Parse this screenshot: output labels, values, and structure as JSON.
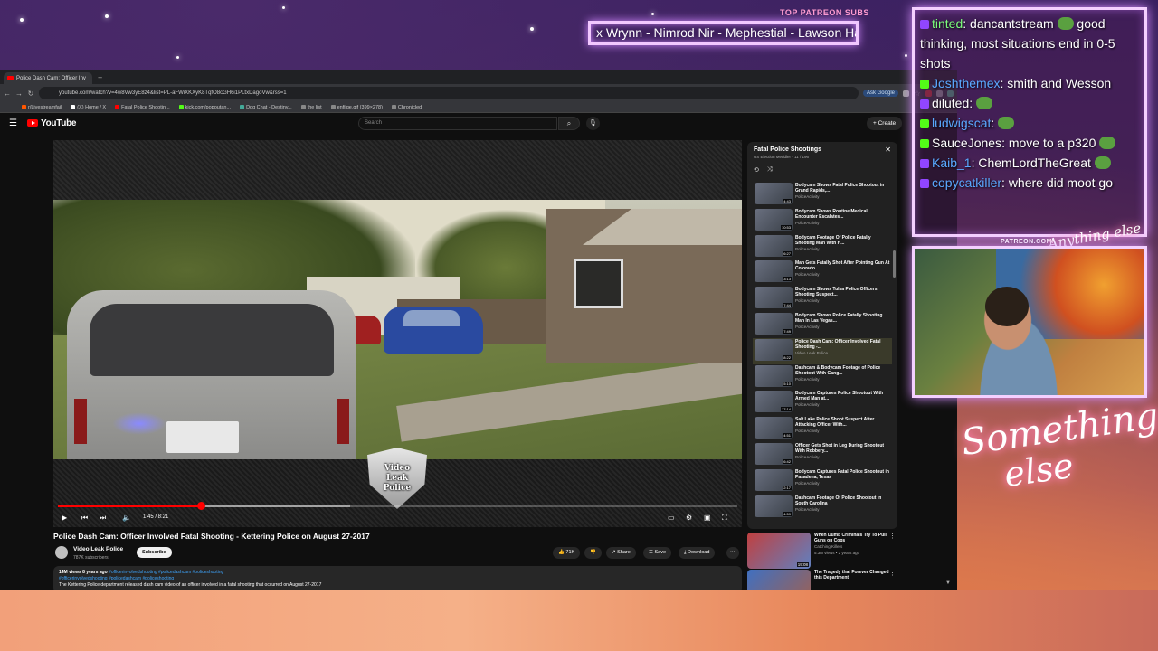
{
  "overlay": {
    "top_subs_label": "TOP PATREON SUBS",
    "top_subs_names": "x Wrynn - Nimrod Nir - Mephestial - Lawson Ha",
    "patreon_url": "PATREON.COM/",
    "signature_small": "Anything else",
    "signature_large_1": "Something",
    "signature_large_2": "else"
  },
  "chat": [
    {
      "user": "tinted",
      "user_color": "#7cfc7c",
      "badge": "twitch",
      "text": "dancantstream",
      "emote_after": true,
      "text2": "good thinking, most situations end in 0-5 shots"
    },
    {
      "user": "Joshthemex",
      "user_color": "#5aa8ff",
      "badge": "kick",
      "text": "smith and Wesson",
      "emote_after": false,
      "text2": ""
    },
    {
      "user": "diluted",
      "user_color": "#ffffff",
      "badge": "twitch",
      "text": "",
      "emote_after": true,
      "text2": ""
    },
    {
      "user": "ludwigscat",
      "user_color": "#5aa8ff",
      "badge": "kick",
      "text": "",
      "emote_after": true,
      "text2": ""
    },
    {
      "user": "SauceJones",
      "user_color": "#ffffff",
      "badge": "kick",
      "text": "move to a p320",
      "emote_after": true,
      "text2": ""
    },
    {
      "user": "Kaib_1",
      "user_color": "#5aa8ff",
      "badge": "twitch",
      "text": "ChemLordTheGreat",
      "emote_after": true,
      "text2": ""
    },
    {
      "user": "copycatkiller",
      "user_color": "#5aa8ff",
      "badge": "twitch",
      "text": "where did moot go",
      "emote_after": false,
      "text2": ""
    }
  ],
  "browser": {
    "tab_title": "Police Dash Cam: Officer Inv",
    "url": "youtube.com/watch?v=4w8Vw3yE8z4&list=PL-aFWiXKXyK8TqfO8cGH6i1PLtxDagoVw&rss=1",
    "ask_google": "Ask Google",
    "bookmarks": [
      "r/Livestreamfail",
      "(X) Home / X",
      "Fatal Police Shootin...",
      "kick.com/popoutan...",
      "Dgg Chat - Destiny...",
      "the list",
      "enfilge.gif (399×278)",
      "Chronicled"
    ]
  },
  "youtube": {
    "logo": "YouTube",
    "search_placeholder": "Search",
    "create": "Create",
    "badge_line1": "Video",
    "badge_line2": "Leak",
    "badge_line3": "Police",
    "time": "1:45 / 8:21",
    "progress_fraction": 0.21,
    "buffered_fraction": 0.43,
    "video_title": "Police Dash Cam: Officer Involved Fatal Shooting - Kettering Police on August 27-2017",
    "channel_name": "Video Leak Police",
    "channel_subs": "787K subscribers",
    "subscribe": "Subscribe",
    "likes": "71K",
    "share": "Share",
    "save": "Save",
    "download": "Download",
    "desc_meta": "14M views  8 years ago",
    "desc_tags1": "#officerinvolvedshooting #policedashcam #policeshooting",
    "desc_tags2": "#officerinvolvedshooting #policedashcam #policeshooting",
    "desc_line": "The Kettering Police department released dash cam video of an officer involved in a fatal shooting that occurred on August 27-2017"
  },
  "playlist": {
    "title": "Fatal Police Shootings",
    "subtitle": "US Election Meddler - 11 / 196",
    "items": [
      {
        "title": "Bodycam Shows Fatal Police Shootout in Grand Rapids,...",
        "channel": "PoliceActivity",
        "dur": "4:43"
      },
      {
        "title": "Bodycam Shows Routine Medical Encounter Escalates...",
        "channel": "PoliceActivity",
        "dur": "10:53"
      },
      {
        "title": "Bodycam Footage Of Police Fatally Shooting Man With H...",
        "channel": "PoliceActivity",
        "dur": "6:27"
      },
      {
        "title": "Man Gets Fatally Shot After Pointing Gun At Colorado...",
        "channel": "PoliceActivity",
        "dur": "3:13"
      },
      {
        "title": "Bodycam Shows Tulsa Police Officers Shooting Suspect...",
        "channel": "PoliceActivity",
        "dur": "7:44"
      },
      {
        "title": "Bodycam Shows Police Fatally Shooting Man In Las Vegas...",
        "channel": "PoliceActivity",
        "dur": "7:49"
      },
      {
        "title": "Police Dash Cam: Officer Involved Fatal Shooting -...",
        "channel": "Video Leak Police",
        "dur": "8:22"
      },
      {
        "title": "Dashcam & Bodycam Footage of Police Shootout With Gang...",
        "channel": "PoliceActivity",
        "dur": "5:10"
      },
      {
        "title": "Bodycam Captures Police Shootout With Armed Man at...",
        "channel": "PoliceActivity",
        "dur": "17:14"
      },
      {
        "title": "Salt Lake Police Shoot Suspect After Attacking Officer With...",
        "channel": "PoliceActivity",
        "dur": "4:51"
      },
      {
        "title": "Officer Gets Shot in Leg During Shootout With Robbery...",
        "channel": "PoliceActivity",
        "dur": "6:42"
      },
      {
        "title": "Bodycam Captures Fatal Police Shootout in Pasadena, Texas",
        "channel": "PoliceActivity",
        "dur": "2:17"
      },
      {
        "title": "Dashcam Footage Of Police Shootout in South Carolina",
        "channel": "PoliceActivity",
        "dur": "4:59"
      }
    ],
    "current_index": 6
  },
  "recommendations": [
    {
      "title": "When Dumb Criminals Try To Pull Guns on Cops",
      "channel": "Catching Killers",
      "meta": "5.3M views • 2 years ago",
      "dur": "19:08"
    },
    {
      "title": "The Tragedy that Forever Changed this Department",
      "channel": "",
      "meta": "",
      "dur": ""
    }
  ]
}
